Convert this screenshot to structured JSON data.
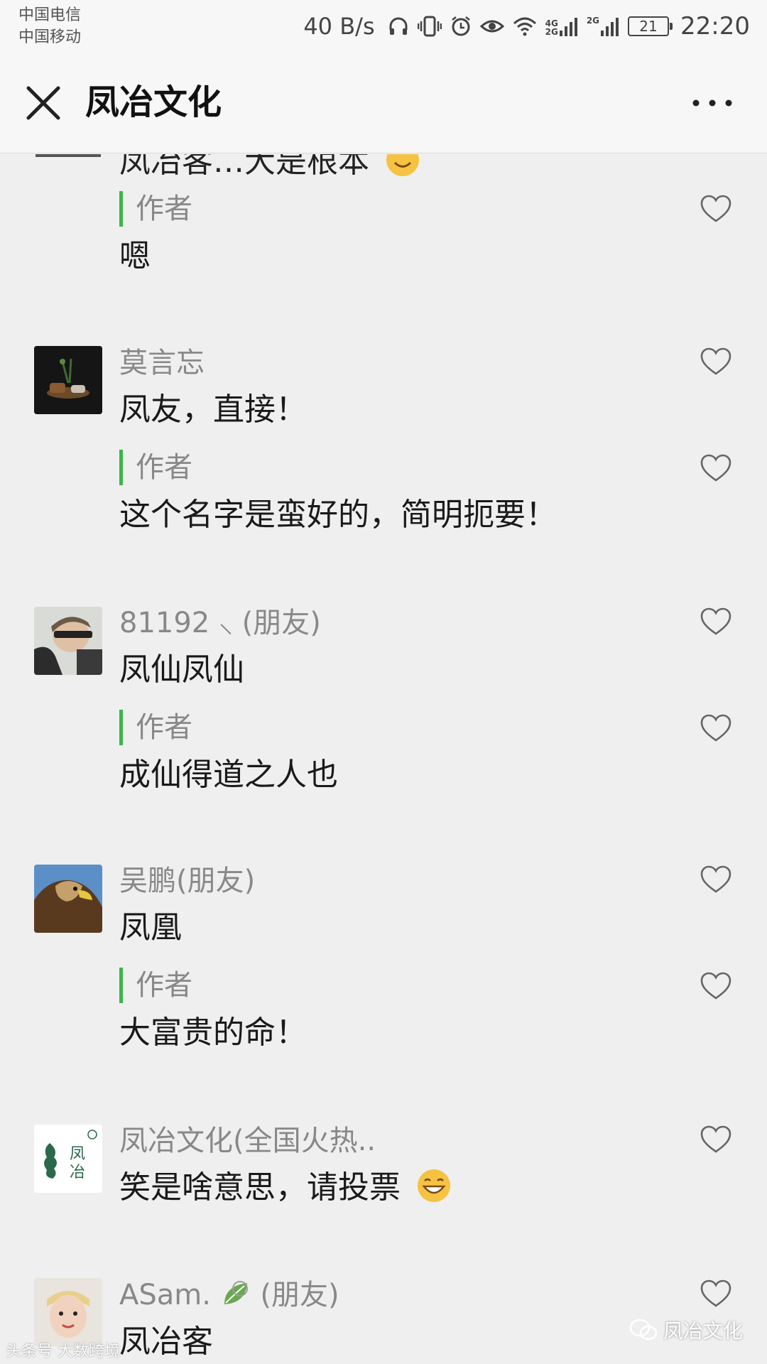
{
  "status_bar": {
    "carrier_1": "中国电信",
    "carrier_2": "中国移动",
    "net_rate": "40 B/s",
    "signal_1_label_top": "4G",
    "signal_1_label_bottom": "2G",
    "signal_2_label": "2G",
    "battery_level": "21",
    "time": "22:20"
  },
  "header": {
    "title": "凤冶文化",
    "close_icon": "close-icon",
    "more_icon": "more-icon"
  },
  "comments": {
    "partial_text": "凤冶客…大是根本",
    "c0": {
      "reply_label": "作者",
      "reply_text": "嗯"
    },
    "c1": {
      "name": "莫言忘",
      "text": "凤友，直接！",
      "reply_label": "作者",
      "reply_text": "这个名字是蛮好的，简明扼要！"
    },
    "c2": {
      "name": "81192 ⸜ (朋友)",
      "text": "凤仙凤仙",
      "reply_label": "作者",
      "reply_text": "成仙得道之人也"
    },
    "c3": {
      "name": "吴鹏(朋友)",
      "text": "凤凰",
      "reply_label": "作者",
      "reply_text": "大富贵的命！"
    },
    "c4": {
      "name": "凤冶文化(全国火热..",
      "text": "笑是啥意思，请投票"
    },
    "c5": {
      "name": "ASam.",
      "name_suffix": "(朋友)",
      "text": "凤冶客"
    }
  },
  "watermarks": {
    "left": "头条号 大数跨境",
    "right": "凤冶文化"
  },
  "colors": {
    "accent_green": "#3bb44a",
    "background": "#efeff0",
    "muted_text": "#888888"
  }
}
